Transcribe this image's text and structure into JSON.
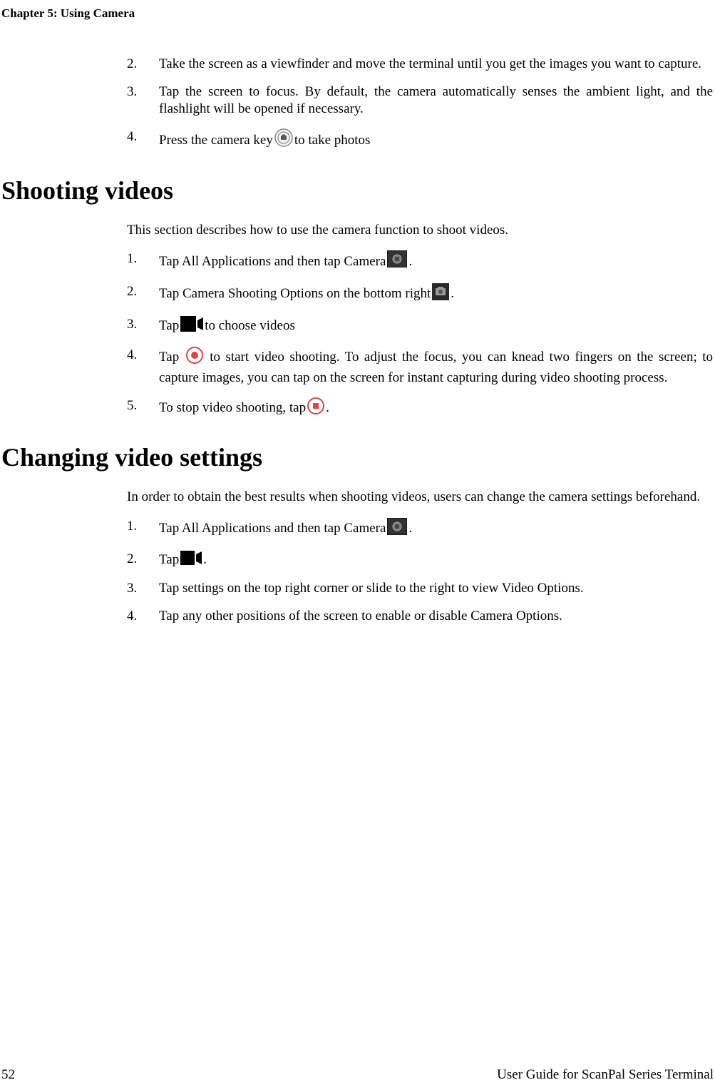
{
  "header": {
    "chapter": "Chapter 5: Using Camera"
  },
  "section1": {
    "items": [
      {
        "num": "2.",
        "text": "Take the screen as a viewfinder and move the terminal until you get the images you want to capture."
      },
      {
        "num": "3.",
        "text": "Tap the screen to focus. By default, the camera automatically senses the ambient light, and the flashlight will be opened if necessary."
      },
      {
        "num": "4.",
        "pre": "Press the camera key ",
        "post": " to take photos"
      }
    ]
  },
  "section2": {
    "title": "Shooting videos",
    "intro": "This section describes how to use the camera function to shoot videos.",
    "items": [
      {
        "num": "1.",
        "pre": "Tap All Applications and then tap Camera",
        "post": "."
      },
      {
        "num": "2.",
        "pre": "Tap Camera Shooting Options on the bottom right",
        "post": "."
      },
      {
        "num": "3.",
        "pre": "Tap  ",
        "post": "  to choose videos"
      },
      {
        "num": "4.",
        "pre": "Tap ",
        "mid": " to start video shooting. To adjust the focus, you can knead two fingers on the screen; to capture images, you can tap on the screen for instant capturing during video shooting process."
      },
      {
        "num": "5.",
        "pre": "To stop video shooting, tap",
        "post": "."
      }
    ]
  },
  "section3": {
    "title": "Changing video settings",
    "intro": "In order to obtain the best results when shooting videos, users can change the camera settings beforehand.",
    "items": [
      {
        "num": "1.",
        "pre": " Tap All Applications and then tap Camera",
        "post": "."
      },
      {
        "num": "2.",
        "pre": " Tap ",
        "post": "."
      },
      {
        "num": "3.",
        "text": " Tap settings on the top right corner or slide to the right to view Video Options."
      },
      {
        "num": "4.",
        "text": "Tap any other positions of the screen to enable or disable Camera Options."
      }
    ]
  },
  "footer": {
    "page": "52",
    "guide": "User Guide for ScanPal Series Terminal"
  }
}
